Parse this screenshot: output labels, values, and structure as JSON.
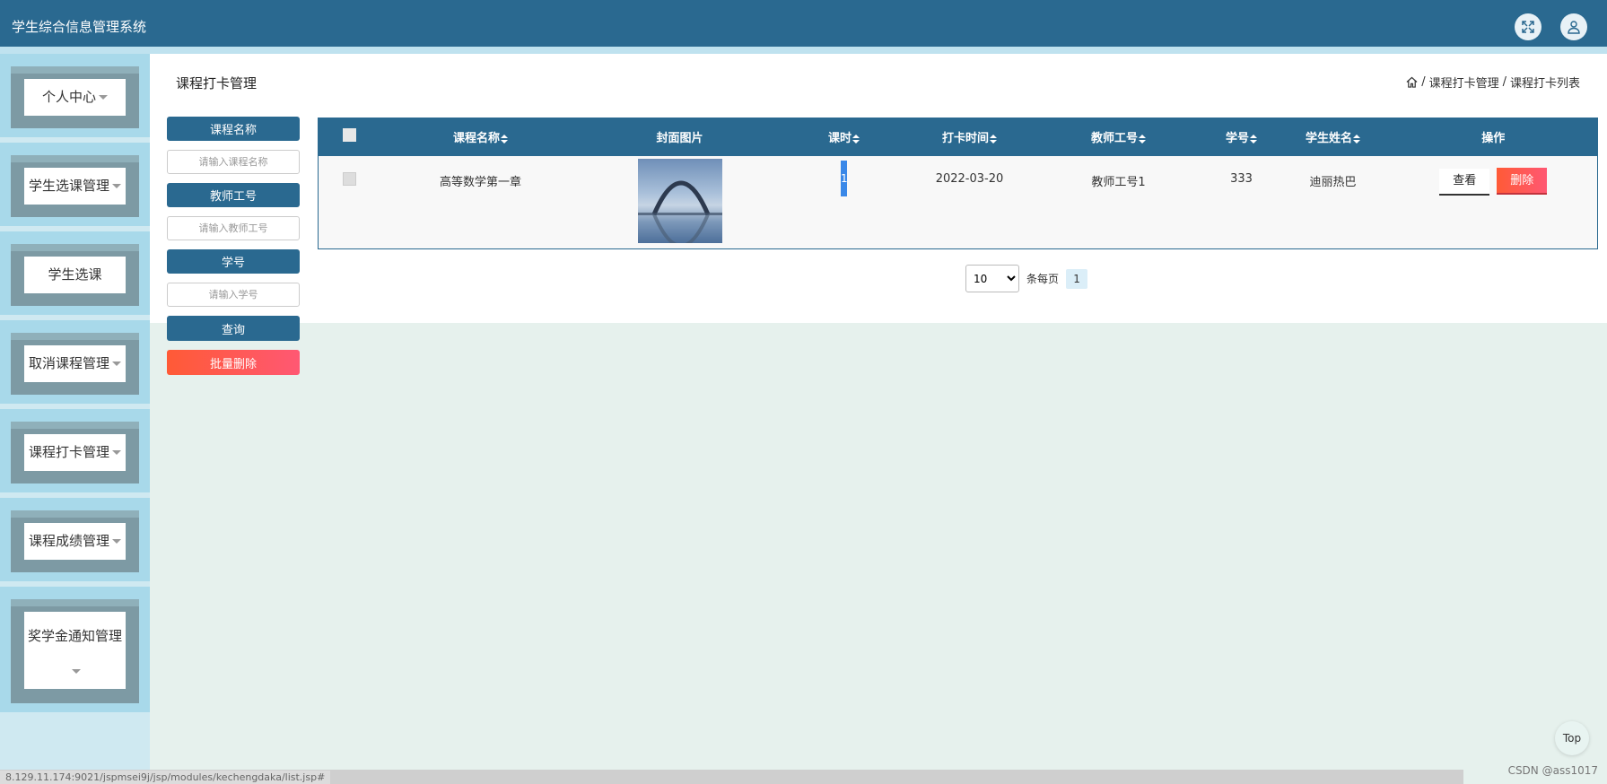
{
  "app": {
    "title": "学生综合信息管理系统"
  },
  "topbar": {
    "fullscreen_icon": "expand-icon",
    "user_icon": "user-icon"
  },
  "sidebar": {
    "items": [
      {
        "label": "个人中心",
        "has_caret": true
      },
      {
        "label": "学生选课管理",
        "has_caret": true
      },
      {
        "label": "学生选课",
        "has_caret": false
      },
      {
        "label": "取消课程管理",
        "has_caret": true
      },
      {
        "label": "课程打卡管理",
        "has_caret": true
      },
      {
        "label": "课程成绩管理",
        "has_caret": true
      },
      {
        "label": "奖学金通知管理",
        "has_caret": true
      }
    ]
  },
  "page": {
    "title": "课程打卡管理"
  },
  "breadcrumb": {
    "home_icon": "home-icon",
    "sep": "/",
    "level1": "课程打卡管理",
    "level2": "课程打卡列表"
  },
  "search": {
    "course_label": "课程名称",
    "course_placeholder": "请输入课程名称",
    "teacher_label": "教师工号",
    "teacher_placeholder": "请输入教师工号",
    "student_label": "学号",
    "student_placeholder": "请输入学号",
    "query_button": "查询",
    "batch_delete_button": "批量删除"
  },
  "table": {
    "headers": [
      "课程名称",
      "封面图片",
      "课时",
      "打卡时间",
      "教师工号",
      "学号",
      "学生姓名",
      "操作"
    ],
    "rows": [
      {
        "course": "高等数学第一章",
        "hours": "1",
        "time": "2022-03-20",
        "teacher_id": "教师工号1",
        "student_id": "333",
        "student_name": "迪丽热巴",
        "view": "查看",
        "delete": "删除"
      }
    ]
  },
  "pager": {
    "page_size": "10",
    "page_size_options": [
      "10"
    ],
    "per_page_text": "条每页",
    "current_page": "1"
  },
  "float": {
    "top_label": "Top"
  },
  "status": {
    "url": "8.129.11.174:9021/jspmsei9j/jsp/modules/kechengdaka/list.jsp#",
    "watermark": "CSDN @ass1017"
  },
  "colors": {
    "primary": "#2a6990",
    "danger": "#ff5a36",
    "sidebar": "#a8d9ea"
  }
}
